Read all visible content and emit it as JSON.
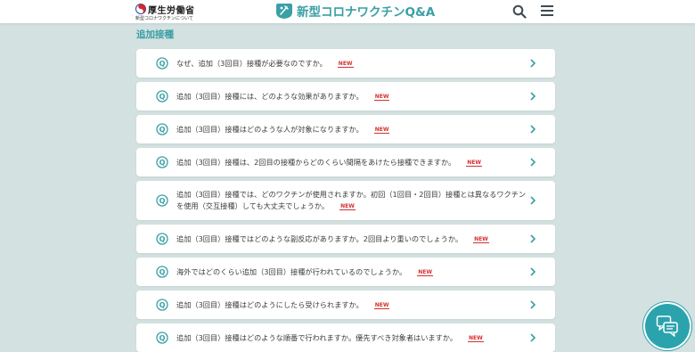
{
  "header": {
    "ministry_name": "厚生労働省",
    "ministry_subtitle": "新型コロナワクチンについて",
    "site_title": "新型コロナワクチンQ&A",
    "search_icon": "search-icon",
    "menu_icon": "hamburger-menu-icon"
  },
  "section": {
    "title": "追加接種"
  },
  "badge_new": "NEW",
  "faq_items": [
    {
      "question": "なぜ、追加（3回目）接種が必要なのですか。"
    },
    {
      "question": "追加（3回目）接種には、どのような効果がありますか。"
    },
    {
      "question": "追加（3回目）接種はどのような人が対象になりますか。"
    },
    {
      "question": "追加（3回目）接種は、2回目の接種からどのくらい間隔をあけたら接種できますか。"
    },
    {
      "question": "追加（3回目）接種では、どのワクチンが使用されますか。初回（1回目・2回目）接種とは異なるワクチンを使用（交互接種）しても大丈夫でしょうか。"
    },
    {
      "question": "追加（3回目）接種ではどのような副反応がありますか。2回目より重いのでしょうか。"
    },
    {
      "question": "海外ではどのくらい追加（3回目）接種が行われているのでしょうか。"
    },
    {
      "question": "追加（3回目）接種はどのようにしたら受けられますか。"
    },
    {
      "question": "追加（3回目）接種はどのような順番で行われますか。優先すべき対象者はいますか。"
    }
  ],
  "chat_icon": "chat-bubbles-icon",
  "colors": {
    "accent": "#3aa0a5",
    "background": "#d3e1e0",
    "new_badge": "#d43030"
  }
}
